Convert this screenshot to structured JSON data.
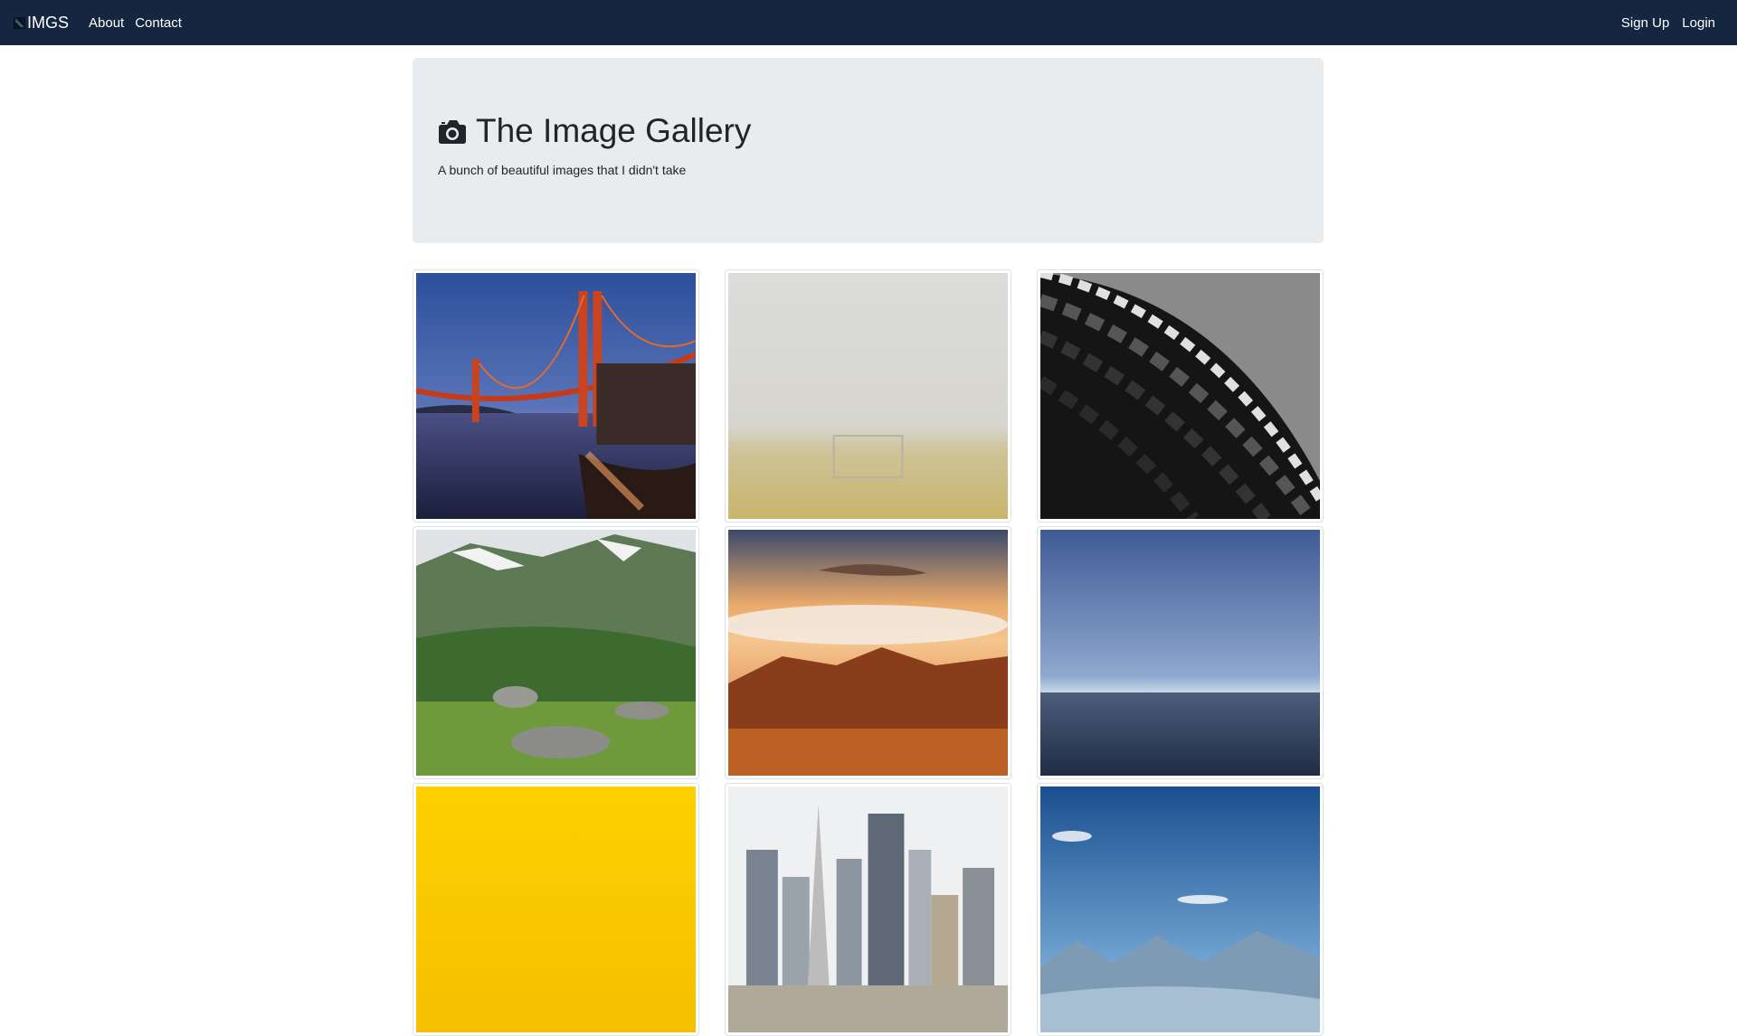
{
  "navbar": {
    "brand": "IMGS",
    "links": [
      "About",
      "Contact"
    ],
    "right_links": [
      "Sign Up",
      "Login"
    ],
    "color": "#142640"
  },
  "jumbotron": {
    "icon": "camera-icon",
    "title": "The Image Gallery",
    "subtitle": "A bunch of beautiful images that I didn't take"
  },
  "gallery": {
    "images": [
      {
        "name": "golden-gate-bridge-image"
      },
      {
        "name": "foggy-field-goal-image"
      },
      {
        "name": "abstract-architecture-image"
      },
      {
        "name": "green-mountain-valley-image"
      },
      {
        "name": "sunset-mountains-clouds-image"
      },
      {
        "name": "calm-sea-horizon-image"
      },
      {
        "name": "yellow-texture-image"
      },
      {
        "name": "city-skyline-image"
      },
      {
        "name": "blue-sky-mountains-image"
      }
    ]
  }
}
